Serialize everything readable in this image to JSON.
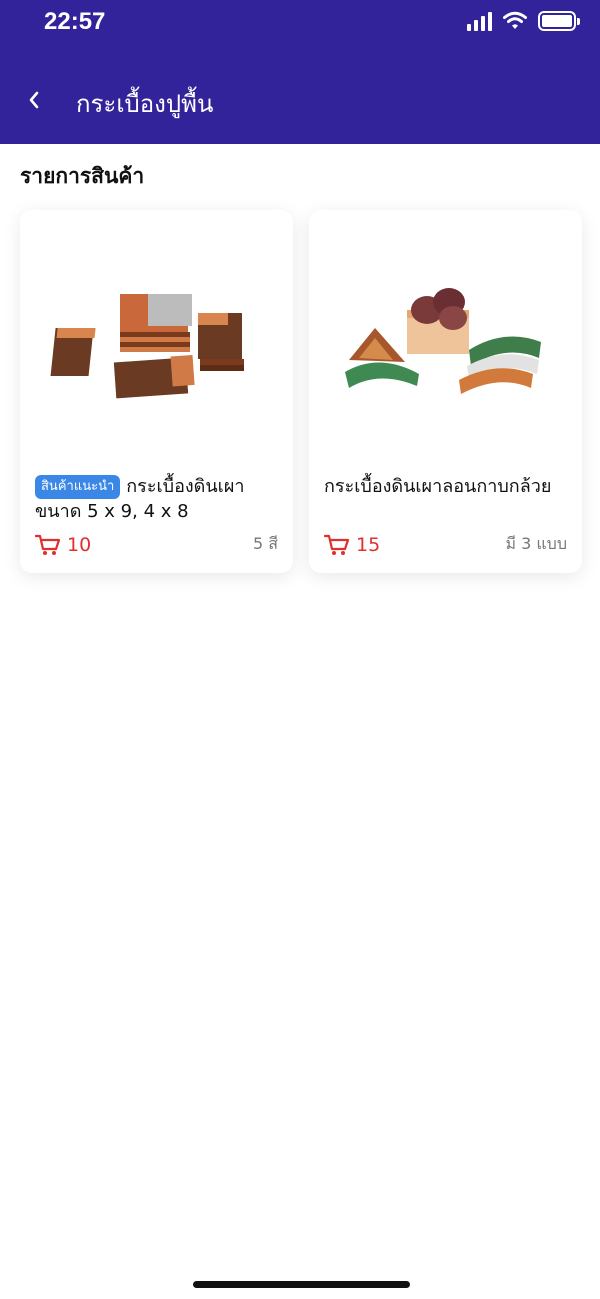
{
  "status_bar": {
    "time": "22:57"
  },
  "header": {
    "title": "กระเบื้องปูพื้น",
    "back_icon": "chevron-left-icon"
  },
  "section": {
    "title": "รายการสินค้า"
  },
  "products": [
    {
      "badge": "สินค้าแนะนำ",
      "name": "กระเบื้องดินเผาขนาด 5 x 9, 4 x 8",
      "count": "10",
      "variant": "5 สี",
      "count_icon": "cart-icon"
    },
    {
      "badge": "",
      "name": "กระเบื้องดินเผาลอนกาบกล้วย",
      "count": "15",
      "variant": "มี 3 แบบ",
      "count_icon": "cart-icon"
    }
  ],
  "colors": {
    "header_bg": "#33239b",
    "badge_bg": "#3a87e8",
    "count_red": "#e0302d"
  }
}
